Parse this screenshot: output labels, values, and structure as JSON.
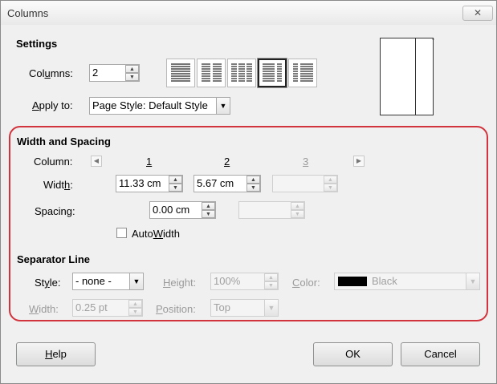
{
  "window": {
    "title": "Columns",
    "close_label": "✕"
  },
  "settings": {
    "heading": "Settings",
    "columns_label": "Columns:",
    "columns_value": "2",
    "apply_to_label": "Apply to:",
    "apply_to_value": "Page Style: Default Style",
    "layout_presets": [
      "1 column",
      "2 columns",
      "3 columns",
      "2 columns, left narrow",
      "2 columns, right narrow"
    ],
    "selected_preset": "2 columns, right narrow"
  },
  "width_spacing": {
    "heading": "Width and Spacing",
    "column_label": "Column:",
    "column_numbers": [
      "1",
      "2",
      "3"
    ],
    "width_label": "Width:",
    "width_values": [
      "11.33 cm",
      "5.67 cm",
      ""
    ],
    "spacing_label": "Spacing:",
    "spacing_values": [
      "0.00 cm",
      ""
    ],
    "autowidth_label": "AutoWidth",
    "autowidth_checked": false
  },
  "separator": {
    "heading": "Separator Line",
    "style_label": "Style:",
    "style_value": "- none -",
    "height_label": "Height:",
    "height_value": "100%",
    "color_label": "Color:",
    "color_value": "Black",
    "color_swatch": "#000000",
    "width_label": "Width:",
    "width_value": "0.25 pt",
    "position_label": "Position:",
    "position_value": "Top"
  },
  "buttons": {
    "help": "Help",
    "ok": "OK",
    "cancel": "Cancel"
  },
  "colors": {
    "highlight_frame": "#d1343d"
  }
}
